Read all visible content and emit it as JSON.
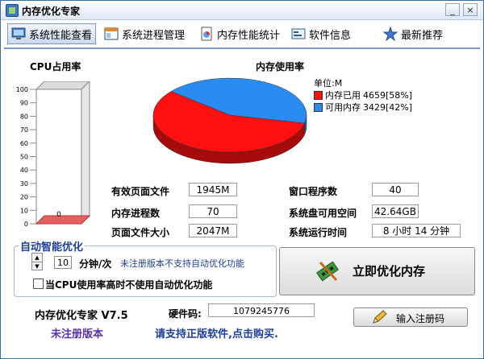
{
  "window": {
    "title": "内存优化专家",
    "close_glyph": "×"
  },
  "menu": {
    "items": [
      {
        "label": "系统性能查看",
        "icon": "monitor-icon",
        "active": true
      },
      {
        "label": "系统进程管理",
        "icon": "window-icon"
      },
      {
        "label": "内存性能统计",
        "icon": "document-chart-icon"
      },
      {
        "label": "软件信息",
        "icon": "info-card-icon"
      },
      {
        "label": "最新推荐",
        "icon": "star-badge-icon"
      }
    ]
  },
  "cpu": {
    "title": "CPU占用率",
    "value_label": "0",
    "ticks": [
      "100",
      "90",
      "80",
      "70",
      "60",
      "50",
      "40",
      "30",
      "20",
      "10",
      "0"
    ]
  },
  "chart_data": {
    "type": "pie",
    "title": "内存使用率",
    "unit_label": "单位:M",
    "slices": [
      {
        "name": "内存已用",
        "value": 4659,
        "percent": 58,
        "color": "#ff1010",
        "text": "4659[58%]"
      },
      {
        "name": "可用内存",
        "value": 3429,
        "percent": 42,
        "color": "#2a8cf0",
        "text": "3429[42%]"
      }
    ]
  },
  "stats": {
    "page_file": {
      "label": "有效页面文件",
      "value": "1945M"
    },
    "processes": {
      "label": "内存进程数",
      "value": "70"
    },
    "page_size": {
      "label": "页面文件大小",
      "value": "2047M"
    },
    "windows": {
      "label": "窗口程序数",
      "value": "40"
    },
    "disk_free": {
      "label": "系统盘可用空间",
      "value": "42.64GB"
    },
    "uptime": {
      "label": "系统运行时间",
      "value": "8 小时 14 分钟"
    }
  },
  "auto": {
    "title": "自动智能优化",
    "interval": "10",
    "unit": "分钟/次",
    "note": "未注册版本不支持自动优化功能",
    "checkbox_label": "当CPU使用率高时不使用自动优化功能"
  },
  "optimize_button": {
    "label": "立即优化内存"
  },
  "footer": {
    "app_name": "内存优化专家 V7.5",
    "hw_label": "硬件码:",
    "hw_code": "1079245776",
    "register_button": "输入注册码",
    "unregistered": "未注册版本",
    "support_text": "请支持正版软件,点击购买."
  },
  "colors": {
    "accent": "#1d3f9e",
    "used": "#ff1010",
    "free": "#2a8cf0"
  }
}
